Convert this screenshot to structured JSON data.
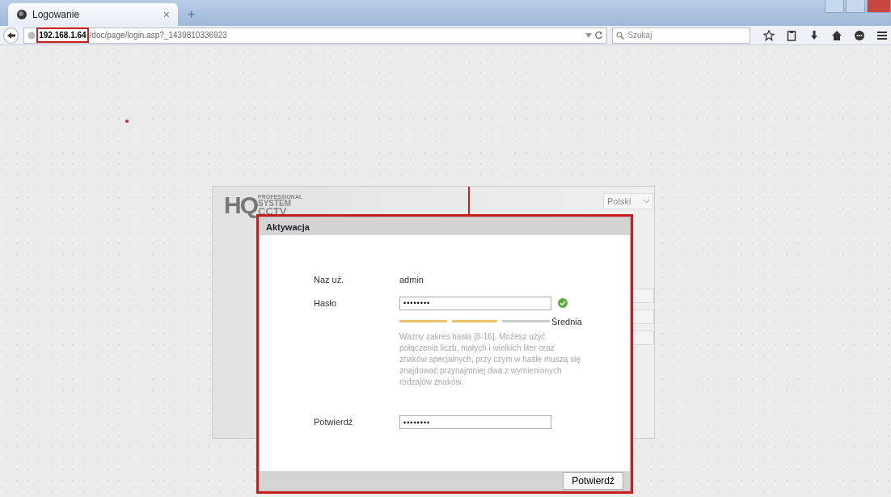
{
  "browser": {
    "tabs": [
      {
        "label": "Logowanie",
        "close": "×",
        "selected": true
      }
    ],
    "new_tab": "+",
    "url": {
      "host": "192.168.1.64",
      "path": "/doc/page/login.asp?_1439810336923",
      "host_highlighted": true
    },
    "search": {
      "placeholder": "Szukaj"
    }
  },
  "login_panel": {
    "logo": {
      "letters": "HQ",
      "line_1": "PROFESSIONAL",
      "line_2": "SYSTEM",
      "line_3": "CCTV"
    },
    "language": "Polski"
  },
  "dialog": {
    "title": "Aktywacja",
    "highlighted": true,
    "fields": [
      {
        "kind": "text",
        "label": "Naz uż.",
        "value": "admin"
      },
      {
        "kind": "password",
        "label": "Hasło",
        "value": "••••••••",
        "valid": true
      },
      {
        "kind": "strength",
        "level": 0.67,
        "reading": "Średnia"
      },
      {
        "kind": "hint",
        "text": "Ważny zakres hasła [8-16]. Możesz użyć połączenia liczb, małych i wielkich liter oraz znaków specjalnych, przy czym w haśle muszą się znajdować przynajmniej dwa z wymienionych rodzajów znaków."
      },
      {
        "kind": "password",
        "label": "Potwierdź",
        "value": "••••••••",
        "valid": false
      }
    ],
    "button": "Potwierdź"
  }
}
